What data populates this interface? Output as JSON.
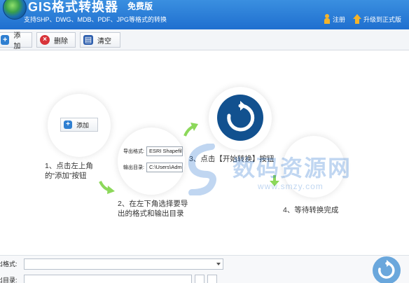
{
  "header": {
    "title": "GIS格式转换器",
    "edition": "免费版",
    "subtitle": "支持SHP、DWG、MDB、PDF、JPG等格式的转换",
    "register_label": "注册",
    "upgrade_label": "升级到正式版",
    "accent": "#1f6fcf"
  },
  "toolbar": {
    "add_label": "添加",
    "delete_label": "删除",
    "clear_label": "清空"
  },
  "guide": {
    "mini_add_label": "添加",
    "mini_export_label": "导出格式:",
    "mini_export_value": "ESRI Shapefile",
    "mini_output_label": "输出目录:",
    "mini_output_value": "C:\\Users\\Adm",
    "step1_line1": "1、点击左上角",
    "step1_line2": "的“添加”按钮",
    "step2_line1": "2、在左下角选择要导",
    "step2_line2": "出的格式和输出目录",
    "step3": "3、点击【开始转换】按钮",
    "step4": "4、等待转换完成"
  },
  "watermark": {
    "text": "数码资源网",
    "url": "www.smzy.com"
  },
  "bottom": {
    "format_label": "导出格式:",
    "dir_label": "输出目录:"
  }
}
